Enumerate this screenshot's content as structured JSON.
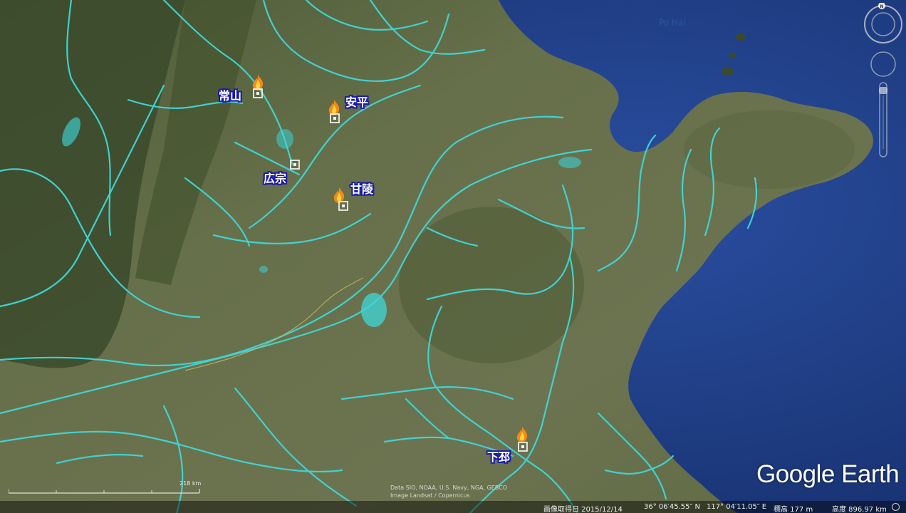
{
  "map": {
    "sea_label": "Po Hai",
    "places": [
      {
        "id": "changshan",
        "label": "常山",
        "has_fire": true
      },
      {
        "id": "anping",
        "label": "安平",
        "has_fire": true
      },
      {
        "id": "guangzong",
        "label": "広宗",
        "has_fire": false
      },
      {
        "id": "ganling",
        "label": "甘陵",
        "has_fire": true
      },
      {
        "id": "xiapi",
        "label": "下邳",
        "has_fire": true
      }
    ],
    "icons": {
      "place_marker": "square-target-icon",
      "fire": "fire-icon"
    },
    "colors": {
      "river": "#3fd8d8",
      "label_outline": "#1a1aa8",
      "sea": "#1e3f86",
      "land": "#5a6a3c"
    }
  },
  "navigation": {
    "north_label": "N"
  },
  "scale": {
    "label": "218 km"
  },
  "attribution": {
    "line1": "Data SIO, NOAA, U.S. Navy, NGA, GEBCO",
    "line2": "Image Landsat / Copernicus"
  },
  "branding": {
    "logo_text": "Google Earth"
  },
  "status_bar": {
    "imagery_date": "画像取得日 2015/12/14",
    "latitude": "36° 06′45.55″ N",
    "longitude": "117° 04′11.05″ E",
    "elevation": "標高 177 m",
    "eye_altitude": "高度 896.97 km"
  }
}
